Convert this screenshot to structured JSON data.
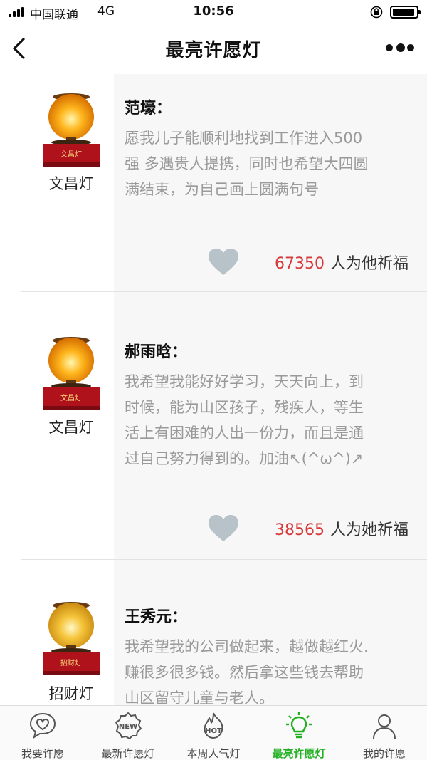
{
  "status_bar": {
    "carrier": "中国联通",
    "network": "4G",
    "time": "10:56"
  },
  "nav": {
    "title": "最亮许愿灯"
  },
  "wishes": [
    {
      "lamp_label": "文昌灯",
      "lamp_plaque": "文昌灯",
      "name": "范壕：",
      "lines": [
        "愿我儿子能顺利地找到工作进入500",
        "强 多遇贵人提携，同时也希望大四圆",
        "满结束，为自己画上圆满句号"
      ],
      "count": "67350",
      "bless_suffix": "人为他祈福"
    },
    {
      "lamp_label": "文昌灯",
      "lamp_plaque": "文昌灯",
      "name": "郝雨晗：",
      "lines": [
        "我希望我能好好学习，天天向上，到",
        "时候，能为山区孩子，残疾人，等生",
        "活上有困难的人出一份力，而且是通",
        "过自己努力得到的。加油↖(^ω^)↗"
      ],
      "count": "38565",
      "bless_suffix": "人为她祈福"
    },
    {
      "lamp_label": "招财灯",
      "lamp_plaque": "招财灯",
      "name": "王秀元：",
      "lines": [
        "我希望我的公司做起来，越做越红火.",
        "赚很多很多钱。然后拿这些钱去帮助",
        "山区留守儿童与老人。"
      ]
    }
  ],
  "tabs": [
    {
      "label": "我要许愿",
      "icon": "heart-chat-icon"
    },
    {
      "label": "最新许愿灯",
      "icon": "new-badge-icon"
    },
    {
      "label": "本周人气灯",
      "icon": "hot-flame-icon"
    },
    {
      "label": "最亮许愿灯",
      "icon": "bulb-icon",
      "active": true
    },
    {
      "label": "我的许愿",
      "icon": "person-icon"
    }
  ],
  "colors": {
    "accent_green": "#22b022",
    "count_red": "#d73a3a",
    "wish_text_gray": "#9a9a9a",
    "heart_gray": "#b7c2c9"
  }
}
